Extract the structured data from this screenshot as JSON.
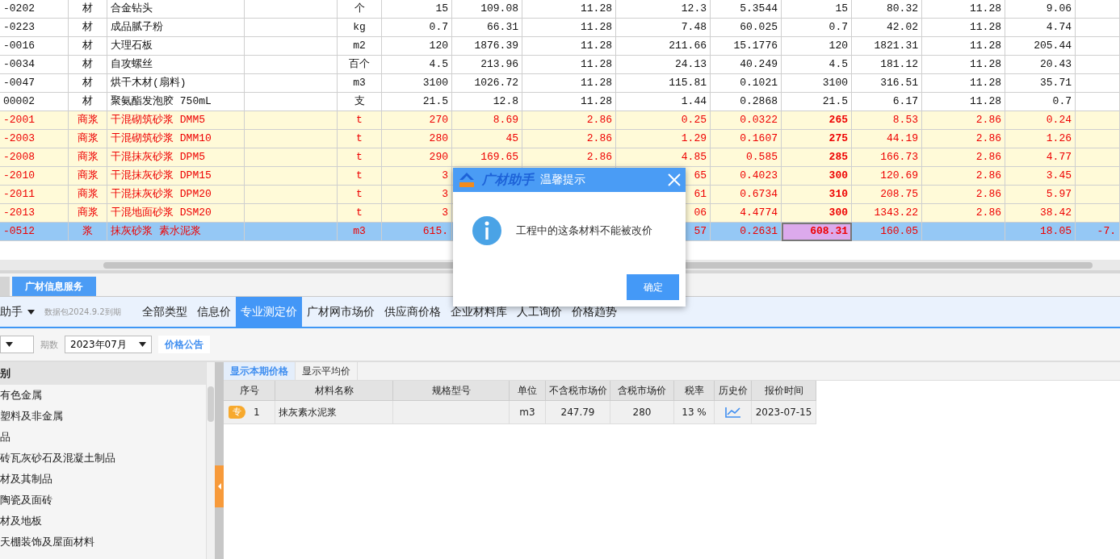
{
  "grid": {
    "rows": [
      {
        "kind": "material",
        "selected": false,
        "cells": [
          "-0202",
          "材",
          "合金钻头",
          null,
          "个",
          "15",
          "109.08",
          "11.28",
          "12.3",
          "5.3544",
          "15",
          "80.32",
          "11.28",
          "9.06",
          null
        ]
      },
      {
        "kind": "material",
        "selected": false,
        "cells": [
          "-0223",
          "材",
          "成品腻子粉",
          null,
          "kg",
          "0.7",
          "66.31",
          "11.28",
          "7.48",
          "60.025",
          "0.7",
          "42.02",
          "11.28",
          "4.74",
          null
        ]
      },
      {
        "kind": "material",
        "selected": false,
        "cells": [
          "-0016",
          "材",
          "大理石板",
          null,
          "m2",
          "120",
          "1876.39",
          "11.28",
          "211.66",
          "15.1776",
          "120",
          "1821.31",
          "11.28",
          "205.44",
          null
        ]
      },
      {
        "kind": "material",
        "selected": false,
        "cells": [
          "-0034",
          "材",
          "自攻螺丝",
          null,
          "百个",
          "4.5",
          "213.96",
          "11.28",
          "24.13",
          "40.249",
          "4.5",
          "181.12",
          "11.28",
          "20.43",
          null
        ]
      },
      {
        "kind": "material",
        "selected": false,
        "cells": [
          "-0047",
          "材",
          "烘干木材(扇料)",
          null,
          "m3",
          "3100",
          "1026.72",
          "11.28",
          "115.81",
          "0.1021",
          "3100",
          "316.51",
          "11.28",
          "35.71",
          null
        ]
      },
      {
        "kind": "material",
        "selected": false,
        "cells": [
          "00002",
          "材",
          "聚氨酯发泡胶 750mL",
          null,
          "支",
          "21.5",
          "12.8",
          "11.28",
          "1.44",
          "0.2868",
          "21.5",
          "6.17",
          "11.28",
          "0.7",
          null
        ]
      },
      {
        "kind": "mortar",
        "selected": false,
        "cells": [
          "-2001",
          "商浆",
          "干混砌筑砂浆 DMM5",
          null,
          "t",
          "270",
          "8.69",
          "2.86",
          "0.25",
          "0.0322",
          "265",
          "8.53",
          "2.86",
          "0.24",
          null
        ]
      },
      {
        "kind": "mortar",
        "selected": false,
        "cells": [
          "-2003",
          "商浆",
          "干混砌筑砂浆 DMM10",
          null,
          "t",
          "280",
          "45",
          "2.86",
          "1.29",
          "0.1607",
          "275",
          "44.19",
          "2.86",
          "1.26",
          null
        ]
      },
      {
        "kind": "mortar",
        "selected": false,
        "cells": [
          "-2008",
          "商浆",
          "干混抹灰砂浆 DPM5",
          null,
          "t",
          "290",
          "169.65",
          "2.86",
          "4.85",
          "0.585",
          "285",
          "166.73",
          "2.86",
          "4.77",
          null
        ]
      },
      {
        "kind": "mortar",
        "selected": false,
        "cells": [
          "-2010",
          "商浆",
          "干混抹灰砂浆 DPM15",
          null,
          "t",
          "3",
          null,
          null,
          "65",
          "0.4023",
          "300",
          "120.69",
          "2.86",
          "3.45",
          null
        ]
      },
      {
        "kind": "mortar",
        "selected": false,
        "cells": [
          "-2011",
          "商浆",
          "干混抹灰砂浆 DPM20",
          null,
          "t",
          "3",
          null,
          null,
          "61",
          "0.6734",
          "310",
          "208.75",
          "2.86",
          "5.97",
          null
        ]
      },
      {
        "kind": "mortar",
        "selected": false,
        "cells": [
          "-2013",
          "商浆",
          "干混地面砂浆 DSM20",
          null,
          "t",
          "3",
          null,
          null,
          "06",
          "4.4774",
          "300",
          "1343.22",
          "2.86",
          "38.42",
          null
        ]
      },
      {
        "kind": "slurry",
        "selected": true,
        "cells": [
          "-0512",
          "浆",
          "抹灰砂浆 素水泥浆",
          null,
          "m3",
          "615.",
          null,
          null,
          "57",
          "0.2631",
          {
            "text": "608.31",
            "active": true
          },
          "160.05",
          null,
          "18.05",
          "-7."
        ]
      }
    ]
  },
  "lower_tabs": [
    {
      "selected": false
    },
    {
      "label": "广材信息服务",
      "selected": true
    }
  ],
  "toolbar": {
    "brand": "助手",
    "package_note": "数据包2024.9.2到期",
    "tabs": [
      {
        "label": "全部类型",
        "selected": false
      },
      {
        "label": "信息价",
        "selected": false
      },
      {
        "label": "专业测定价",
        "selected": true
      },
      {
        "label": "广材网市场价",
        "selected": false
      },
      {
        "label": "供应商价格",
        "selected": false
      },
      {
        "label": "企业材料库",
        "selected": false
      },
      {
        "label": "人工询价",
        "selected": false
      },
      {
        "label": "价格趋势",
        "selected": false
      }
    ]
  },
  "filters": {
    "period_label": "期数",
    "period": "2023年07月",
    "notice_button": "价格公告"
  },
  "category_panel": {
    "header": "别",
    "items": [
      "有色金属",
      "塑料及非金属",
      "品",
      "砖瓦灰砂石及混凝土制品",
      "材及其制品",
      "陶瓷及面砖",
      "材及地板",
      "天棚装饰及屋面材料"
    ]
  },
  "price_panel": {
    "view_tabs": [
      {
        "label": "显示本期价格",
        "selected": true
      },
      {
        "label": "显示平均价",
        "selected": false
      }
    ],
    "columns": [
      "序号",
      "材料名称",
      "规格型号",
      "单位",
      "不含税市场价",
      "含税市场价",
      "税率",
      "历史价",
      "报价时间"
    ],
    "rows": [
      {
        "badge": "专",
        "no": "1",
        "name": "抹灰素水泥浆",
        "unit": "m3",
        "price_ex_tax": "247.79",
        "price_inc_tax": "280",
        "tax_rate": "13 %",
        "quote_date": "2023-07-15"
      }
    ]
  },
  "dialog": {
    "brand": "广材助手",
    "title": "温馨提示",
    "message": "工程中的这条材料不能被改价",
    "button": "确定"
  }
}
